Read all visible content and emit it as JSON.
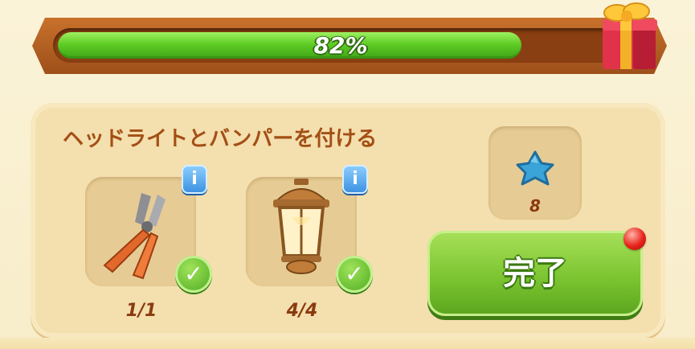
{
  "progress": {
    "percent_label": "82%",
    "value": 0.82
  },
  "task": {
    "title": "ヘッドライトとバンパーを付ける",
    "items": [
      {
        "icon": "pliers-icon",
        "count": "1/1",
        "info_label": "i",
        "done": true
      },
      {
        "icon": "lantern-icon",
        "count": "4/4",
        "info_label": "i",
        "done": true
      }
    ]
  },
  "reward": {
    "icon": "blue-star-icon",
    "count": "8",
    "color": "#3aa3d8"
  },
  "complete_button": {
    "label": "完了"
  },
  "colors": {
    "accent_green": "#7cc531",
    "title_brown": "#a34f15",
    "info_blue": "#3a8fe0"
  }
}
